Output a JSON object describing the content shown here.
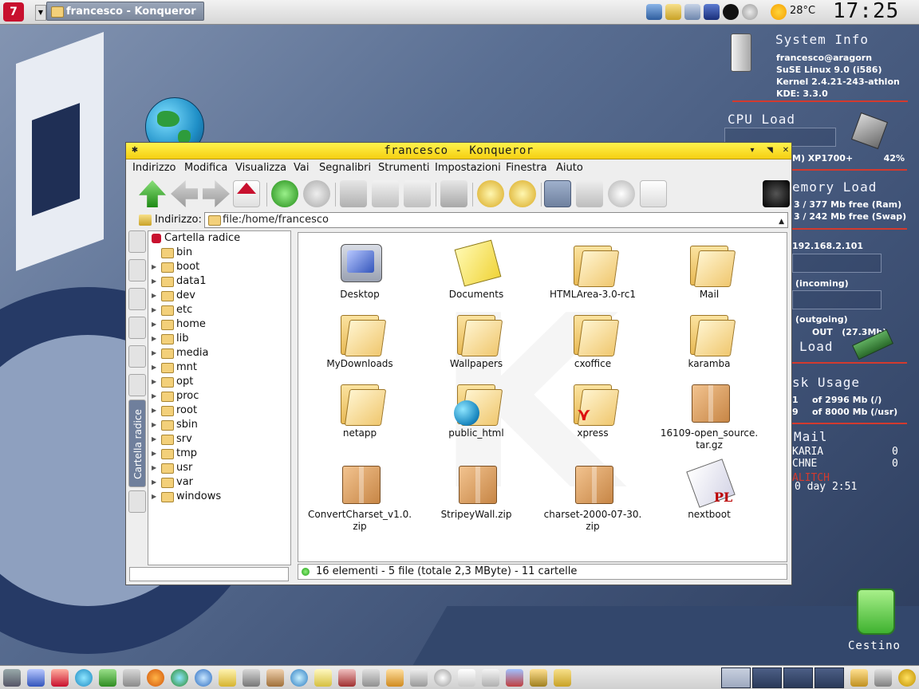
{
  "top_panel": {
    "kmenu_label": "7",
    "task_title": "francesco - Konqueror",
    "temperature": "28°C",
    "clock": "17:25"
  },
  "sysinfo": {
    "heading": "System Info",
    "user": "francesco@aragorn",
    "os": "SuSE Linux 9.0 (i586)",
    "kernel": "Kernel 2.4.21-243-athlon",
    "kde": "KDE: 3.3.0",
    "cpu_heading": "CPU Load",
    "cpu_model": "M) XP1700+",
    "cpu_percent": "42%",
    "mem_heading": "emory Load",
    "ram": "3 / 377 Mb free (Ram)",
    "swap": "3 / 242 Mb free (Swap)",
    "ip": "192.168.2.101",
    "incoming": "(incoming)",
    "outgoing": "(outgoing)",
    "out_total": "OUT   (27.3Mb)",
    "net_heading": "Load",
    "disk_heading": "sk Usage",
    "disk_root_prefix": "1",
    "disk_root": "of 2996 Mb (/)",
    "disk_usr_prefix": "9",
    "disk_usr": "of 8000 Mb (/usr)",
    "mail_heading": "Mail",
    "mail_box1": "KARIA",
    "mail_box1_count": "0",
    "mail_box2": "CHNE",
    "mail_box2_count": "0",
    "mail_box3": "ALITCH",
    "uptime": "0 day 2:51"
  },
  "desktop": {
    "trash_label": "Cestino"
  },
  "window": {
    "title": "francesco - Konqueror",
    "menu": [
      "Indirizzo",
      "Modifica",
      "Visualizza",
      "Vai",
      "Segnalibri",
      "Strumenti",
      "Impostazioni",
      "Finestra",
      "Aiuto"
    ],
    "location_label": "Indirizzo:",
    "location_value": "file:/home/francesco",
    "tree_root": "Cartella radice",
    "tree_items": [
      "bin",
      "boot",
      "data1",
      "dev",
      "etc",
      "home",
      "lib",
      "media",
      "mnt",
      "opt",
      "proc",
      "root",
      "sbin",
      "srv",
      "tmp",
      "usr",
      "var",
      "windows"
    ],
    "sidebar_tab_label": "Cartella radice",
    "files": [
      {
        "name": "Desktop",
        "kind": "desktop"
      },
      {
        "name": "Documents",
        "kind": "documents"
      },
      {
        "name": "HTMLArea-3.0-rc1",
        "kind": "folder"
      },
      {
        "name": "Mail",
        "kind": "folder"
      },
      {
        "name": "MyDownloads",
        "kind": "folder"
      },
      {
        "name": "Wallpapers",
        "kind": "folder"
      },
      {
        "name": "cxoffice",
        "kind": "folder"
      },
      {
        "name": "karamba",
        "kind": "folder"
      },
      {
        "name": "netapp",
        "kind": "folder"
      },
      {
        "name": "public_html",
        "kind": "folder-globe"
      },
      {
        "name": "xpress",
        "kind": "folder-pdf"
      },
      {
        "name": "16109-open_source.\ntar.gz",
        "kind": "archive"
      },
      {
        "name": "ConvertCharset_v1.0.\nzip",
        "kind": "archive"
      },
      {
        "name": "StripeyWall.zip",
        "kind": "archive"
      },
      {
        "name": "charset-2000-07-30.\nzip",
        "kind": "archive"
      },
      {
        "name": "nextboot",
        "kind": "nextboot"
      }
    ],
    "status": "16 elementi - 5 file (totale 2,3 MByte) - 11 cartelle"
  },
  "colors": {
    "titlebar": "#f5cf12",
    "accent_red": "#c8102e",
    "folder": "#f0c870"
  }
}
